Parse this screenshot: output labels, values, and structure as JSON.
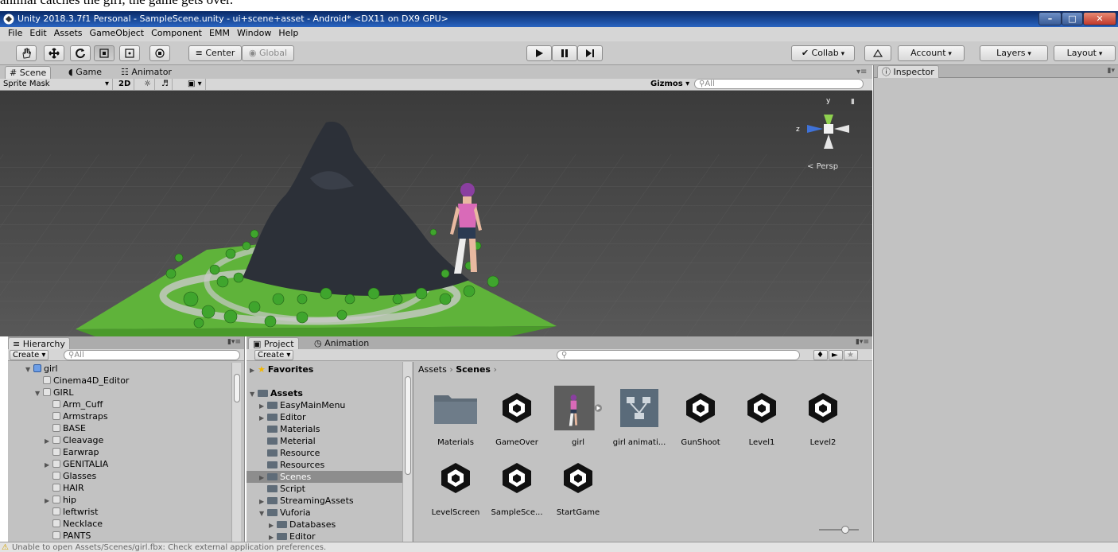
{
  "caption": "animal catches the girl, the game gets over.",
  "window": {
    "title": "Unity 2018.3.7f1 Personal - SampleScene.unity - ui+scene+asset - Android* <DX11 on DX9 GPU>",
    "controls": [
      "minimize",
      "maximize",
      "close"
    ]
  },
  "menu": [
    "File",
    "Edit",
    "Assets",
    "GameObject",
    "Component",
    "EMM",
    "Window",
    "Help"
  ],
  "toolbar": {
    "tools": [
      "hand-tool",
      "move-tool",
      "rotate-tool",
      "scale-tool",
      "rect-tool",
      "transform-tool"
    ],
    "pivot_label": "Center",
    "space_label": "Global",
    "collab_label": "Collab",
    "account_label": "Account",
    "layers_label": "Layers",
    "layout_label": "Layout"
  },
  "scene_tabs": [
    {
      "label": "Scene",
      "icon": "hash-icon",
      "active": true
    },
    {
      "label": "Game",
      "icon": "pacman-icon",
      "active": false
    },
    {
      "label": "Animator",
      "icon": "animator-icon",
      "active": false
    }
  ],
  "scene_options": {
    "draw_mode": "Sprite Mask",
    "mode_2d": "2D",
    "gizmos_label": "Gizmos",
    "search_placeholder": "All"
  },
  "gizmo": {
    "y": "y",
    "z": "z",
    "projection": "Persp"
  },
  "inspector": {
    "title": "Inspector"
  },
  "hierarchy": {
    "tab": "Hierarchy",
    "create": "Create",
    "search_placeholder": "All",
    "items": [
      {
        "label": "girl",
        "depth": 0,
        "arrow": "open",
        "icon": "blue"
      },
      {
        "label": "Cinema4D_Editor",
        "depth": 1,
        "arrow": "",
        "icon": "grey"
      },
      {
        "label": "GIRL",
        "depth": 1,
        "arrow": "open",
        "icon": "grey"
      },
      {
        "label": "Arm_Cuff",
        "depth": 2,
        "arrow": "",
        "icon": "grey"
      },
      {
        "label": "Armstraps",
        "depth": 2,
        "arrow": "",
        "icon": "grey"
      },
      {
        "label": "BASE",
        "depth": 2,
        "arrow": "",
        "icon": "grey"
      },
      {
        "label": "Cleavage",
        "depth": 2,
        "arrow": "closed",
        "icon": "grey"
      },
      {
        "label": "Earwrap",
        "depth": 2,
        "arrow": "",
        "icon": "grey"
      },
      {
        "label": "GENITALIA",
        "depth": 2,
        "arrow": "closed",
        "icon": "grey"
      },
      {
        "label": "Glasses",
        "depth": 2,
        "arrow": "",
        "icon": "grey"
      },
      {
        "label": "HAIR",
        "depth": 2,
        "arrow": "",
        "icon": "grey"
      },
      {
        "label": "hip",
        "depth": 2,
        "arrow": "closed",
        "icon": "grey"
      },
      {
        "label": "leftwrist",
        "depth": 2,
        "arrow": "",
        "icon": "grey"
      },
      {
        "label": "Necklace",
        "depth": 2,
        "arrow": "",
        "icon": "grey"
      },
      {
        "label": "PANTS",
        "depth": 2,
        "arrow": "",
        "icon": "grey"
      }
    ]
  },
  "project": {
    "tabs": [
      "Project",
      "Animation"
    ],
    "create": "Create",
    "breadcrumb": [
      "Assets",
      "Scenes"
    ],
    "tree": [
      {
        "label": "Favorites",
        "depth": 0,
        "arrow": "closed",
        "bold": true,
        "icon": "star"
      },
      {
        "label": "",
        "depth": 0,
        "arrow": "",
        "icon": "none"
      },
      {
        "label": "Assets",
        "depth": 0,
        "arrow": "open",
        "bold": true,
        "icon": "folder"
      },
      {
        "label": "EasyMainMenu",
        "depth": 1,
        "arrow": "closed",
        "icon": "folder"
      },
      {
        "label": "Editor",
        "depth": 1,
        "arrow": "closed",
        "icon": "folder"
      },
      {
        "label": "Materials",
        "depth": 1,
        "arrow": "",
        "icon": "folder"
      },
      {
        "label": "Meterial",
        "depth": 1,
        "arrow": "",
        "icon": "folder"
      },
      {
        "label": "Resource",
        "depth": 1,
        "arrow": "",
        "icon": "folder"
      },
      {
        "label": "Resources",
        "depth": 1,
        "arrow": "",
        "icon": "folder"
      },
      {
        "label": "Scenes",
        "depth": 1,
        "arrow": "closed",
        "icon": "folder",
        "selected": true
      },
      {
        "label": "Script",
        "depth": 1,
        "arrow": "",
        "icon": "folder"
      },
      {
        "label": "StreamingAssets",
        "depth": 1,
        "arrow": "closed",
        "icon": "folder"
      },
      {
        "label": "Vuforia",
        "depth": 1,
        "arrow": "open",
        "icon": "folder"
      },
      {
        "label": "Databases",
        "depth": 2,
        "arrow": "closed",
        "icon": "folder"
      },
      {
        "label": "Editor",
        "depth": 2,
        "arrow": "closed",
        "icon": "folder"
      }
    ],
    "assets": [
      {
        "label": "Materials",
        "kind": "folder"
      },
      {
        "label": "GameOver",
        "kind": "unity"
      },
      {
        "label": "girl",
        "kind": "model"
      },
      {
        "label": "girl animati...",
        "kind": "animator"
      },
      {
        "label": "GunShoot",
        "kind": "unity"
      },
      {
        "label": "Level1",
        "kind": "unity"
      },
      {
        "label": "Level2",
        "kind": "unity"
      },
      {
        "label": "LevelScreen",
        "kind": "unity"
      },
      {
        "label": "SampleSce...",
        "kind": "unity"
      },
      {
        "label": "StartGame",
        "kind": "unity"
      }
    ]
  },
  "status": {
    "message": "Unable to open Assets/Scenes/girl.fbx: Check external application preferences."
  },
  "colors": {
    "title_bar": "#1b4d9e",
    "panel": "#c2c2c2",
    "ground": "#5fb33a",
    "rock": "#2c3038",
    "accent_pink": "#d96ab8"
  }
}
